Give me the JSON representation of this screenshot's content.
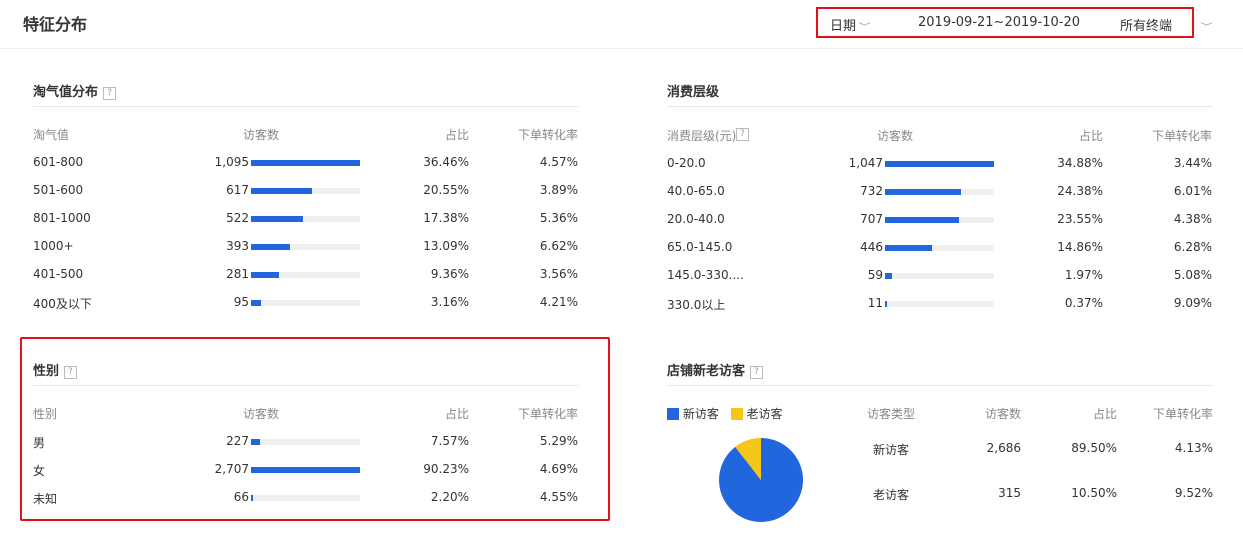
{
  "header": {
    "title": "特征分布",
    "date_label": "日期",
    "date_range": "2019-09-21~2019-10-20",
    "terminal": "所有终端"
  },
  "taoqi": {
    "title": "淘气值分布",
    "help": "?",
    "columns": [
      "淘气值",
      "访客数",
      "占比",
      "下单转化率"
    ],
    "rows": [
      {
        "label": "601-800",
        "visitors": "1,095",
        "ratio": "36.46%",
        "conv": "4.57%",
        "fill": 1.0
      },
      {
        "label": "501-600",
        "visitors": "617",
        "ratio": "20.55%",
        "conv": "3.89%",
        "fill": 0.56
      },
      {
        "label": "801-1000",
        "visitors": "522",
        "ratio": "17.38%",
        "conv": "5.36%",
        "fill": 0.48
      },
      {
        "label": "1000+",
        "visitors": "393",
        "ratio": "13.09%",
        "conv": "6.62%",
        "fill": 0.36
      },
      {
        "label": "401-500",
        "visitors": "281",
        "ratio": "9.36%",
        "conv": "3.56%",
        "fill": 0.26
      },
      {
        "label": "400及以下",
        "visitors": "95",
        "ratio": "3.16%",
        "conv": "4.21%",
        "fill": 0.09
      }
    ]
  },
  "consume": {
    "title": "消费层级",
    "columns": [
      "消费层级(元)",
      "访客数",
      "占比",
      "下单转化率"
    ],
    "help": "?",
    "rows": [
      {
        "label": "0-20.0",
        "visitors": "1,047",
        "ratio": "34.88%",
        "conv": "3.44%",
        "fill": 1.0
      },
      {
        "label": "40.0-65.0",
        "visitors": "732",
        "ratio": "24.38%",
        "conv": "6.01%",
        "fill": 0.7
      },
      {
        "label": "20.0-40.0",
        "visitors": "707",
        "ratio": "23.55%",
        "conv": "4.38%",
        "fill": 0.68
      },
      {
        "label": "65.0-145.0",
        "visitors": "446",
        "ratio": "14.86%",
        "conv": "6.28%",
        "fill": 0.43
      },
      {
        "label": "145.0-330....",
        "visitors": "59",
        "ratio": "1.97%",
        "conv": "5.08%",
        "fill": 0.06
      },
      {
        "label": "330.0以上",
        "visitors": "11",
        "ratio": "0.37%",
        "conv": "9.09%",
        "fill": 0.01
      }
    ]
  },
  "gender": {
    "title": "性别",
    "help": "?",
    "columns": [
      "性别",
      "访客数",
      "占比",
      "下单转化率"
    ],
    "rows": [
      {
        "label": "男",
        "visitors": "227",
        "ratio": "7.57%",
        "conv": "5.29%",
        "fill": 0.08
      },
      {
        "label": "女",
        "visitors": "2,707",
        "ratio": "90.23%",
        "conv": "4.69%",
        "fill": 1.0
      },
      {
        "label": "未知",
        "visitors": "66",
        "ratio": "2.20%",
        "conv": "4.55%",
        "fill": 0.02
      }
    ]
  },
  "shop": {
    "title": "店铺新老访客",
    "help": "?",
    "legend": [
      {
        "label": "新访客",
        "color": "#2266dd"
      },
      {
        "label": "老访客",
        "color": "#f5c518"
      }
    ],
    "columns": [
      "访客类型",
      "访客数",
      "占比",
      "下单转化率"
    ],
    "rows": [
      {
        "label": "新访客",
        "visitors": "2,686",
        "ratio": "89.50%",
        "conv": "4.13%"
      },
      {
        "label": "老访客",
        "visitors": "315",
        "ratio": "10.50%",
        "conv": "9.52%"
      }
    ],
    "pie_fraction_new": 0.895
  },
  "colors": {
    "accent": "#2266dd",
    "secondary": "#f5c518",
    "highlight": "#e0101c"
  }
}
